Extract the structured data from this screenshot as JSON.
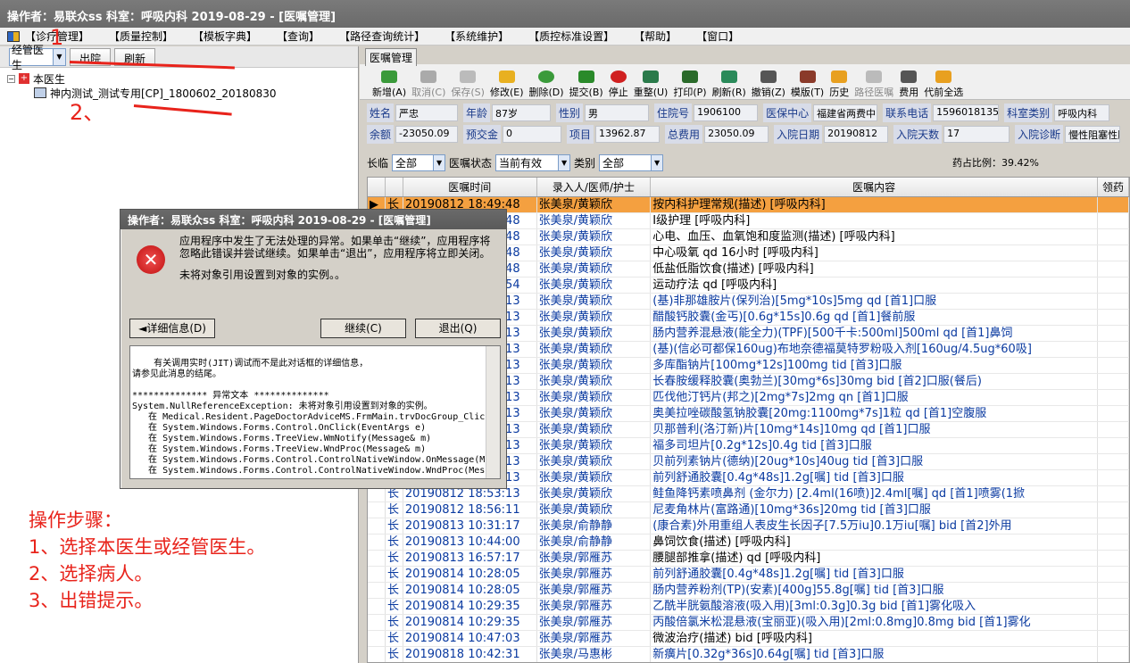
{
  "window": {
    "title": "操作者：易联众ss  科室：呼吸内科  2019-08-29 - [医嘱管理]"
  },
  "menu": [
    "【诊疗管理】",
    "【质量控制】",
    "【模板字典】",
    "【查询】",
    "【路径查询统计】",
    "【系统维护】",
    "【质控标准设置】",
    "【帮助】",
    "【窗口】"
  ],
  "left": {
    "combo_value": "经管医生",
    "btn_outhospital": "出院",
    "btn_refresh": "刷新",
    "tree_root": "本医生",
    "tree_child": "神内测试_测试专用[CP]_1800602_20180830"
  },
  "annotations": {
    "a1": "1",
    "a2": "2、",
    "a3": "3、",
    "steps": [
      "操作步骤：",
      "1、选择本医生或经管医生。",
      "2、选择病人。",
      "3、出错提示。"
    ]
  },
  "tab": "医嘱管理",
  "toolbar": [
    "新增(A)",
    "取消(C)",
    "保存(S)",
    "修改(E)",
    "删除(D)",
    "提交(B)",
    "停止",
    "重整(U)",
    "打印(P)",
    "刷新(R)",
    "撤销(Z)",
    "模版(T)",
    "历史",
    "路径医嘱",
    "费用",
    "代前全选"
  ],
  "patient": {
    "name_l": "姓名",
    "name": "严忠",
    "age_l": "年龄",
    "age": "87岁",
    "sex_l": "性别",
    "sex": "男",
    "inno_l": "住院号",
    "inno": "1906100",
    "center_l": "医保中心",
    "center": "福建省两费中",
    "phone_l": "联系电话",
    "phone": "15960181359",
    "dept_l": "科室类别",
    "dept": "呼吸内科",
    "bal_l": "余额",
    "bal": "-23050.09",
    "pre_l": "预交金",
    "pre": "0",
    "item_l": "项目",
    "item": "13962.87",
    "total_l": "总费用",
    "total": "23050.09",
    "indate_l": "入院日期",
    "indate": "20190812",
    "days_l": "入院天数",
    "days": "17",
    "diag_l": "入院诊断",
    "diag": "慢性阻塞性肺"
  },
  "filters": {
    "longtemp_l": "长临",
    "longtemp": "全部",
    "status_l": "医嘱状态",
    "status": "当前有效",
    "cat_l": "类别",
    "cat": "全部",
    "ratio": "药占比例：39.42%"
  },
  "grid_headers": [
    "医嘱时间",
    "录入人/医师/护士",
    "医嘱内容",
    "领药"
  ],
  "rows": [
    [
      "长",
      "20190812 18:49:48",
      "张美泉/黄颖欣",
      "按内科护理常规(描述)      [呼吸内科]"
    ],
    [
      "长",
      "20190812 18:49:48",
      "张美泉/黄颖欣",
      "Ⅰ级护理     [呼吸内科]"
    ],
    [
      "长",
      "20190812 18:49:48",
      "张美泉/黄颖欣",
      "心电、血压、血氧饱和度监测(描述)     [呼吸内科]"
    ],
    [
      "长",
      "20190812 18:49:48",
      "张美泉/黄颖欣",
      "中心吸氧  qd 16小时 [呼吸内科]"
    ],
    [
      "长",
      "20190812 18:49:48",
      "张美泉/黄颖欣",
      "低盐低脂饮食(描述)     [呼吸内科]"
    ],
    [
      "长",
      "20190812 18:49:54",
      "张美泉/黄颖欣",
      "运动疗法  qd  [呼吸内科]"
    ],
    [
      "长",
      "20190812 18:50:13",
      "张美泉/黄颖欣",
      "(基)非那雄胺片(保列治)[5mg*10s]5mg qd [首1]口服"
    ],
    [
      "长",
      "20190812 18:50:13",
      "张美泉/黄颖欣",
      "醋酸钙胶囊(金丐)[0.6g*15s]0.6g qd [首1]餐前服"
    ],
    [
      "长",
      "20190812 18:50:13",
      "张美泉/黄颖欣",
      "肠内营养混悬液(能全力)(TPF)[500千卡:500ml]500ml qd [首1]鼻饲"
    ],
    [
      "长",
      "20190812 18:50:13",
      "张美泉/黄颖欣",
      "(基)(信必可都保160ug)布地奈德福莫特罗粉吸入剂[160ug/4.5ug*60吸]"
    ],
    [
      "长",
      "20190812 18:50:13",
      "张美泉/黄颖欣",
      "多库酯钠片[100mg*12s]100mg tid [首3]口服"
    ],
    [
      "长",
      "20190812 18:50:13",
      "张美泉/黄颖欣",
      "长春胺缓释胶囊(奥勃兰)[30mg*6s]30mg bid [首2]口服(餐后)"
    ],
    [
      "长",
      "20190812 18:50:13",
      "张美泉/黄颖欣",
      "匹伐他汀钙片(邦之)[2mg*7s]2mg qn [首1]口服"
    ],
    [
      "长",
      "20190812 18:50:13",
      "张美泉/黄颖欣",
      "奥美拉唑碳酸氢钠胶囊[20mg:1100mg*7s]1粒 qd [首1]空腹服"
    ],
    [
      "长",
      "20190812 18:50:13",
      "张美泉/黄颖欣",
      "贝那普利(洛汀新)片[10mg*14s]10mg qd [首1]口服"
    ],
    [
      "长",
      "20190812 18:50:13",
      "张美泉/黄颖欣",
      "福多司坦片[0.2g*12s]0.4g tid [首3]口服"
    ],
    [
      "长",
      "20190812 18:50:13",
      "张美泉/黄颖欣",
      "贝前列素钠片(德纳)[20ug*10s]40ug tid [首3]口服"
    ],
    [
      "长",
      "20190812 18:50:13",
      "张美泉/黄颖欣",
      "前列舒通胶囊[0.4g*48s]1.2g[嘱] tid [首3]口服"
    ],
    [
      "长",
      "20190812 18:53:13",
      "张美泉/黄颖欣",
      "鲑鱼降钙素喷鼻剂 (金尔力) [2.4ml(16喷)]2.4ml[嘱] qd [首1]喷雾(1掀"
    ],
    [
      "长",
      "20190812 18:56:11",
      "张美泉/黄颖欣",
      "尼麦角林片(富路通)[10mg*36s]20mg tid [首3]口服"
    ],
    [
      "长",
      "20190813 10:31:17",
      "张美泉/俞静静",
      "(康合素)外用重组人表皮生长因子[7.5万iu]0.1万iu[嘱] bid [首2]外用"
    ],
    [
      "长",
      "20190813 10:44:00",
      "张美泉/俞静静",
      "鼻饲饮食(描述)     [呼吸内科]"
    ],
    [
      "长",
      "20190813 16:57:17",
      "张美泉/郭雁苏",
      "腰腿部推拿(描述)  qd  [呼吸内科]"
    ],
    [
      "长",
      "20190814 10:28:05",
      "张美泉/郭雁苏",
      "前列舒通胶囊[0.4g*48s]1.2g[嘱] tid [首3]口服"
    ],
    [
      "长",
      "20190814 10:28:05",
      "张美泉/郭雁苏",
      "肠内营养粉剂(TP)(安素)[400g]55.8g[嘱] tid [首3]口服"
    ],
    [
      "长",
      "20190814 10:29:35",
      "张美泉/郭雁苏",
      "乙酰半胱氨酸溶液(吸入用)[3ml:0.3g]0.3g bid [首1]雾化吸入"
    ],
    [
      "长",
      "20190814 10:29:35",
      "张美泉/郭雁苏",
      "丙酸倍氯米松混悬液(宝丽亚)(吸入用)[2ml:0.8mg]0.8mg bid [首1]雾化"
    ],
    [
      "长",
      "20190814 10:47:03",
      "张美泉/郭雁苏",
      "微波治疗(描述)  bid  [呼吸内科]"
    ],
    [
      "长",
      "20190818 10:42:31",
      "张美泉/马惠彬",
      "新癀片[0.32g*36s]0.64g[嘱] tid [首3]口服"
    ]
  ],
  "dialog": {
    "title": "操作者：易联众ss  科室：呼吸内科  2019-08-29 - [医嘱管理]",
    "msg1": "应用程序中发生了无法处理的异常。如果单击“继续”，应用程序将忽略此错误并尝试继续。如果单击“退出”，应用程序将立即关闭。",
    "msg2": "未将对象引用设置到对象的实例。。",
    "btn_detail": "详细信息(D)",
    "btn_continue": "继续(C)",
    "btn_exit": "退出(Q)",
    "detail": "有关调用实时(JIT)调试而不是此对话框的详细信息，\n请参见此消息的结尾。\n\n************** 异常文本 **************\nSystem.NullReferenceException: 未将对象引用设置到对象的实例。\n   在 Medical.Resident.PageDoctorAdviceMS.FrmMain.trvDocGroup_Clic\n   在 System.Windows.Forms.Control.OnClick(EventArgs e)\n   在 System.Windows.Forms.TreeView.WmNotify(Message& m)\n   在 System.Windows.Forms.TreeView.WndProc(Message& m)\n   在 System.Windows.Forms.Control.ControlNativeWindow.OnMessage(M\n   在 System.Windows.Forms.Control.ControlNativeWindow.WndProc(Mes"
  }
}
